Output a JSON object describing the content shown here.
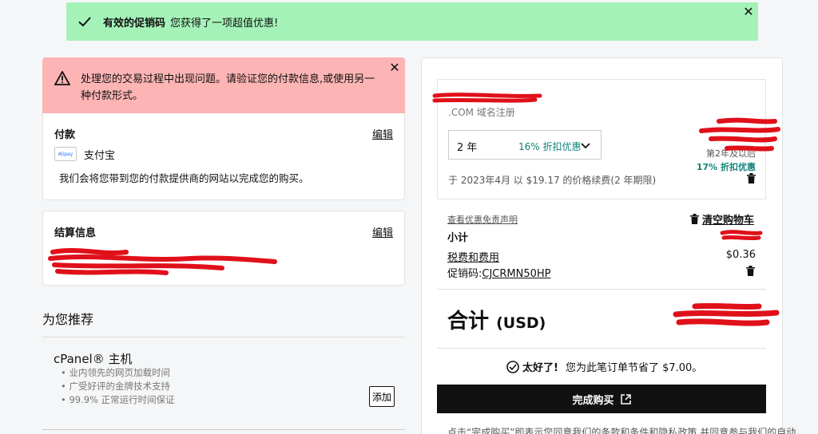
{
  "success_toast": {
    "title": "有效的促销码",
    "message": "您获得了一项超值优惠!"
  },
  "error_alert": {
    "message": "处理您的交易过程中出现问题。请验证您的付款信息,或使用另一种付款形式。"
  },
  "payment": {
    "title": "付款",
    "edit_label": "编辑",
    "method_logo_text": "Alipay",
    "method_name": "支付宝",
    "description": "我们会将您带到您的付款提供商的网站以完成您的购买。"
  },
  "billing": {
    "title": "结算信息",
    "edit_label": "编辑"
  },
  "recommendations": {
    "title": "为您推荐",
    "item_name": "cPanel® 主机",
    "features": [
      "业内领先的网页加载时间",
      "广受好评的金牌技术支持",
      "99.9% 正常运行时间保证"
    ],
    "add_label": "添加"
  },
  "summary": {
    "product_subtitle": ".COM 域名注册",
    "term_selected": "2 年",
    "term_discount": "16% 折扣优惠",
    "year2_label": "第2年及以后",
    "year2_discount": "17% 折扣优惠",
    "renewal_note": "于 2023年4月 以 $19.17 的价格续费(2 年期限)",
    "disclaimer_link": "查看优惠免责声明",
    "clear_cart_label": "清空购物车",
    "subtotal_label": "小计",
    "taxes_label": "税费和费用",
    "taxes_value": "$0.36",
    "promo_label": "促销码:",
    "promo_code": "CJCRMN50HP",
    "total_label": "合计",
    "total_currency": "(USD)",
    "savings_bold": "太好了!",
    "savings_text": "您为此笔订单节省了 $7.00。",
    "buy_label": "完成购买",
    "legal_text": "点击“完成购买”即表示您同意我们的条款和条件和隐私政策,并同意参与我们的自动"
  },
  "colors": {
    "success_bg": "#a5f2b8",
    "error_bg": "#fdb4b4",
    "discount_teal": "#11847a",
    "redaction_red": "#e0101a",
    "button_black": "#111111"
  }
}
